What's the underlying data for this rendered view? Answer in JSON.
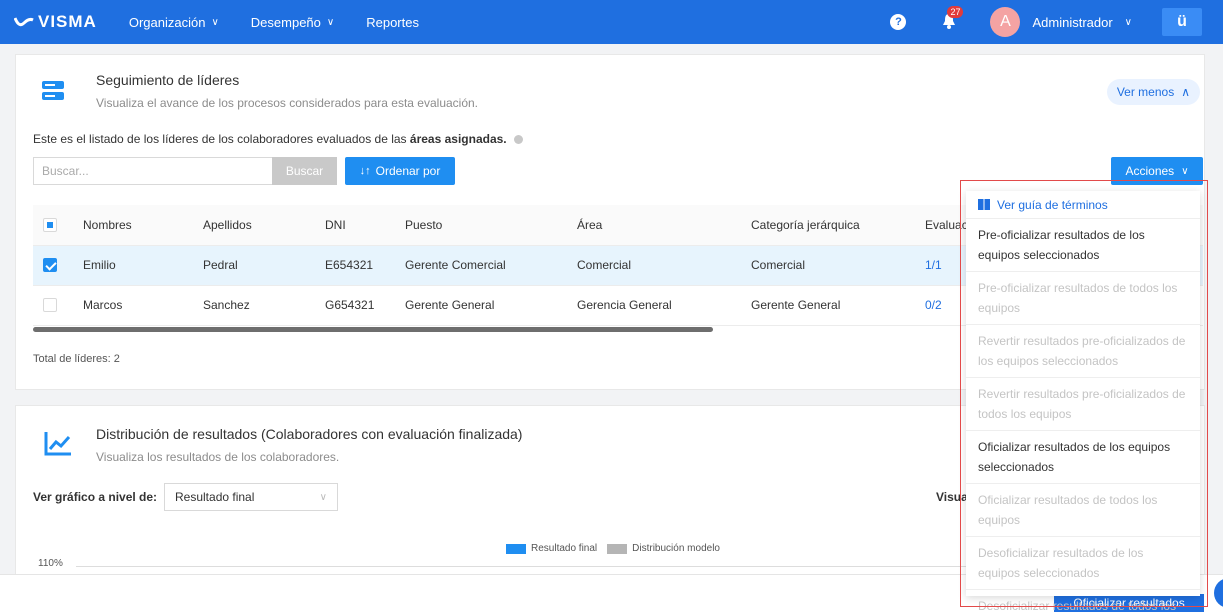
{
  "nav": {
    "logo": "VISMA",
    "items": [
      {
        "label": "Organización"
      },
      {
        "label": "Desempeño"
      },
      {
        "label": "Reportes"
      }
    ],
    "help": "?",
    "notifications_count": "27",
    "avatar_initial": "A",
    "user_name": "Administrador",
    "apps_label": "ü"
  },
  "leaders": {
    "title": "Seguimiento de líderes",
    "subtitle": "Visualiza el avance de los procesos considerados para esta evaluación.",
    "toggle_label": "Ver menos",
    "desc_prefix": "Este es el listado de los líderes de los colaboradores evaluados de las ",
    "desc_bold": "áreas asignadas.",
    "search_placeholder": "Buscar...",
    "search_button": "Buscar",
    "order_button": "Ordenar por",
    "actions_button": "Acciones",
    "columns": [
      "Nombres",
      "Apellidos",
      "DNI",
      "Puesto",
      "Área",
      "Categoría jerárquica",
      "Evaluac"
    ],
    "rows": [
      {
        "nombres": "Emilio",
        "apellidos": "Pedral",
        "dni": "E654321",
        "puesto": "Gerente Comercial",
        "area": "Comercial",
        "categoria": "Comercial",
        "eval": "1/1",
        "selected": true
      },
      {
        "nombres": "Marcos",
        "apellidos": "Sanchez",
        "dni": "G654321",
        "puesto": "Gerente General",
        "area": "Gerencia General",
        "categoria": "Gerente General",
        "eval": "0/2",
        "selected": false
      }
    ],
    "total": "Total de líderes: 2"
  },
  "distribution": {
    "title_bold": "Distribución de resultados",
    "title_rest": " (Colaboradores con evaluación finalizada)",
    "subtitle": "Visualiza los resultados de los colaboradores.",
    "level_label": "Ver gráfico a nivel de:",
    "level_value": "Resultado final",
    "visual_label": "Visual",
    "legend": [
      {
        "name": "Resultado final",
        "color": "#1f8ef1"
      },
      {
        "name": "Distribución modelo",
        "color": "#b5b5b5"
      }
    ],
    "y_tick": "110%"
  },
  "footer": {
    "oficializar_button": "Oficializar resultados"
  },
  "actions_menu": {
    "guide": "Ver guía de términos",
    "items": [
      {
        "label": "Pre-oficializar resultados de los equipos seleccionados",
        "enabled": true
      },
      {
        "label": "Pre-oficializar resultados de todos los equipos",
        "enabled": false
      },
      {
        "label": "Revertir resultados pre-oficializados de los equipos seleccionados",
        "enabled": false
      },
      {
        "label": "Revertir resultados pre-oficializados de todos los equipos",
        "enabled": false
      },
      {
        "label": "Oficializar resultados de los equipos seleccionados",
        "enabled": true
      },
      {
        "label": "Oficializar resultados de todos los equipos",
        "enabled": false
      },
      {
        "label": "Desoficializar resultados de los equipos seleccionados",
        "enabled": false
      },
      {
        "label": "Desoficializar resultados de todos los equipos",
        "enabled": false
      }
    ]
  },
  "colors": {
    "primary": "#1f6fe0",
    "button": "#1f8ef1",
    "highlight": "#e24a4a"
  }
}
